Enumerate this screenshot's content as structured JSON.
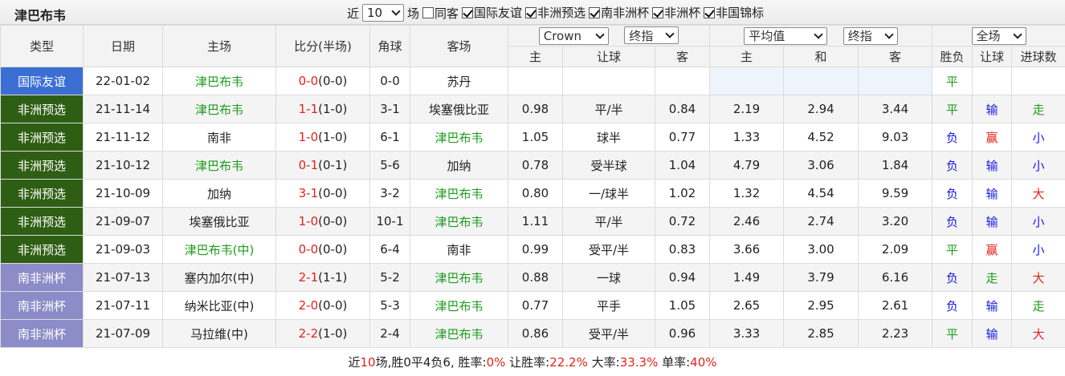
{
  "header": {
    "team": "津巴布韦",
    "near_label": "近",
    "count_value": "10",
    "field_label": "场",
    "same_host": "同客",
    "filters": [
      {
        "label": "国际友谊",
        "checked": true
      },
      {
        "label": "非洲预选",
        "checked": true
      },
      {
        "label": "南非洲杯",
        "checked": true
      },
      {
        "label": "非洲杯",
        "checked": true
      },
      {
        "label": "非国锦标",
        "checked": true
      }
    ]
  },
  "columns": {
    "type": "类型",
    "date": "日期",
    "home": "主场",
    "score": "比分(半场)",
    "corner": "角球",
    "away": "客场",
    "company_select": "Crown",
    "handicap_select": "终指",
    "avg_select": "平均值",
    "avg_final_select": "终指",
    "scope_select": "全场",
    "sub": {
      "home_odds": "主",
      "handicap": "让球",
      "away_odds": "客",
      "win": "主",
      "draw": "和",
      "lose": "客",
      "result": "胜负",
      "handicap_result": "让球",
      "goals": "进球数"
    }
  },
  "colors": {
    "国际友谊": "#3b6fd4",
    "非洲预选": "#2e5e13",
    "南非洲杯": "#8c8cc8"
  },
  "rows": [
    {
      "type": "国际友谊",
      "date": "22-01-02",
      "home": "津巴布韦",
      "home_is_team": true,
      "score_ft": "0-0",
      "score_ht": "(0-0)",
      "score_color": "red",
      "corner": "0-0",
      "away": "苏丹",
      "away_is_team": false,
      "o_home": "",
      "o_hcp": "",
      "o_away": "",
      "a_win": "",
      "a_draw": "",
      "a_lose": "",
      "res": "平",
      "res_color": "green",
      "hres": "",
      "hres_color": "",
      "goals": "",
      "goals_color": ""
    },
    {
      "type": "非洲预选",
      "date": "21-11-14",
      "home": "津巴布韦",
      "home_is_team": true,
      "score_ft": "1-1",
      "score_ht": "(1-0)",
      "score_color": "red",
      "corner": "3-1",
      "away": "埃塞俄比亚",
      "away_is_team": false,
      "o_home": "0.98",
      "o_hcp": "平/半",
      "o_away": "0.84",
      "a_win": "2.19",
      "a_draw": "2.94",
      "a_lose": "3.44",
      "res": "平",
      "res_color": "green",
      "hres": "输",
      "hres_color": "blue",
      "goals": "走",
      "goals_color": "green"
    },
    {
      "type": "非洲预选",
      "date": "21-11-12",
      "home": "南非",
      "home_is_team": false,
      "score_ft": "1-0",
      "score_ht": "(1-0)",
      "score_color": "red",
      "corner": "6-1",
      "away": "津巴布韦",
      "away_is_team": true,
      "o_home": "1.05",
      "o_hcp": "球半",
      "o_away": "0.77",
      "a_win": "1.33",
      "a_draw": "4.52",
      "a_lose": "9.03",
      "res": "负",
      "res_color": "blue",
      "hres": "赢",
      "hres_color": "red",
      "goals": "小",
      "goals_color": "blue"
    },
    {
      "type": "非洲预选",
      "date": "21-10-12",
      "home": "津巴布韦",
      "home_is_team": true,
      "score_ft": "0-1",
      "score_ht": "(0-1)",
      "score_color": "red",
      "corner": "5-6",
      "away": "加纳",
      "away_is_team": false,
      "o_home": "0.78",
      "o_hcp": "受半球",
      "o_away": "1.04",
      "a_win": "4.79",
      "a_draw": "3.06",
      "a_lose": "1.84",
      "res": "负",
      "res_color": "blue",
      "hres": "输",
      "hres_color": "blue",
      "goals": "小",
      "goals_color": "blue"
    },
    {
      "type": "非洲预选",
      "date": "21-10-09",
      "home": "加纳",
      "home_is_team": false,
      "score_ft": "3-1",
      "score_ht": "(0-0)",
      "score_color": "red",
      "corner": "3-2",
      "away": "津巴布韦",
      "away_is_team": true,
      "o_home": "0.80",
      "o_hcp": "一/球半",
      "o_away": "1.02",
      "a_win": "1.32",
      "a_draw": "4.54",
      "a_lose": "9.59",
      "res": "负",
      "res_color": "blue",
      "hres": "输",
      "hres_color": "blue",
      "goals": "大",
      "goals_color": "red"
    },
    {
      "type": "非洲预选",
      "date": "21-09-07",
      "home": "埃塞俄比亚",
      "home_is_team": false,
      "score_ft": "1-0",
      "score_ht": "(0-0)",
      "score_color": "red",
      "corner": "10-1",
      "away": "津巴布韦",
      "away_is_team": true,
      "o_home": "1.11",
      "o_hcp": "平/半",
      "o_away": "0.72",
      "a_win": "2.46",
      "a_draw": "2.74",
      "a_lose": "3.20",
      "res": "负",
      "res_color": "blue",
      "hres": "输",
      "hres_color": "blue",
      "goals": "小",
      "goals_color": "blue"
    },
    {
      "type": "非洲预选",
      "date": "21-09-03",
      "home": "津巴布韦(中)",
      "home_is_team": true,
      "score_ft": "0-0",
      "score_ht": "(0-0)",
      "score_color": "red",
      "corner": "6-4",
      "away": "南非",
      "away_is_team": false,
      "o_home": "0.99",
      "o_hcp": "受平/半",
      "o_away": "0.83",
      "a_win": "3.66",
      "a_draw": "3.00",
      "a_lose": "2.09",
      "res": "平",
      "res_color": "green",
      "hres": "赢",
      "hres_color": "red",
      "goals": "小",
      "goals_color": "blue"
    },
    {
      "type": "南非洲杯",
      "date": "21-07-13",
      "home": "塞内加尔(中)",
      "home_is_team": false,
      "score_ft": "2-1",
      "score_ht": "(1-1)",
      "score_color": "red",
      "corner": "5-2",
      "away": "津巴布韦",
      "away_is_team": true,
      "o_home": "0.88",
      "o_hcp": "一球",
      "o_away": "0.94",
      "a_win": "1.49",
      "a_draw": "3.79",
      "a_lose": "6.16",
      "res": "负",
      "res_color": "blue",
      "hres": "走",
      "hres_color": "green",
      "goals": "大",
      "goals_color": "red"
    },
    {
      "type": "南非洲杯",
      "date": "21-07-11",
      "home": "纳米比亚(中)",
      "home_is_team": false,
      "score_ft": "2-0",
      "score_ht": "(0-0)",
      "score_color": "red",
      "corner": "5-3",
      "away": "津巴布韦",
      "away_is_team": true,
      "o_home": "0.77",
      "o_hcp": "平手",
      "o_away": "1.05",
      "a_win": "2.65",
      "a_draw": "2.95",
      "a_lose": "2.61",
      "res": "负",
      "res_color": "blue",
      "hres": "输",
      "hres_color": "blue",
      "goals": "走",
      "goals_color": "green"
    },
    {
      "type": "南非洲杯",
      "date": "21-07-09",
      "home": "马拉维(中)",
      "home_is_team": false,
      "score_ft": "2-2",
      "score_ht": "(1-0)",
      "score_color": "red",
      "corner": "2-4",
      "away": "津巴布韦",
      "away_is_team": true,
      "o_home": "0.86",
      "o_hcp": "受平/半",
      "o_away": "0.96",
      "a_win": "3.33",
      "a_draw": "2.85",
      "a_lose": "2.23",
      "res": "平",
      "res_color": "green",
      "hres": "输",
      "hres_color": "blue",
      "goals": "大",
      "goals_color": "red"
    }
  ],
  "footer": {
    "p1": "近",
    "n": "10",
    "p2": "场,胜0平4负6, 胜率:",
    "win_rate": "0%",
    "p3": " 让胜率:",
    "hcp_rate": "22.2%",
    "p4": " 大率:",
    "big_rate": "33.3%",
    "p5": " 单率:",
    "odd_rate": "40%"
  }
}
